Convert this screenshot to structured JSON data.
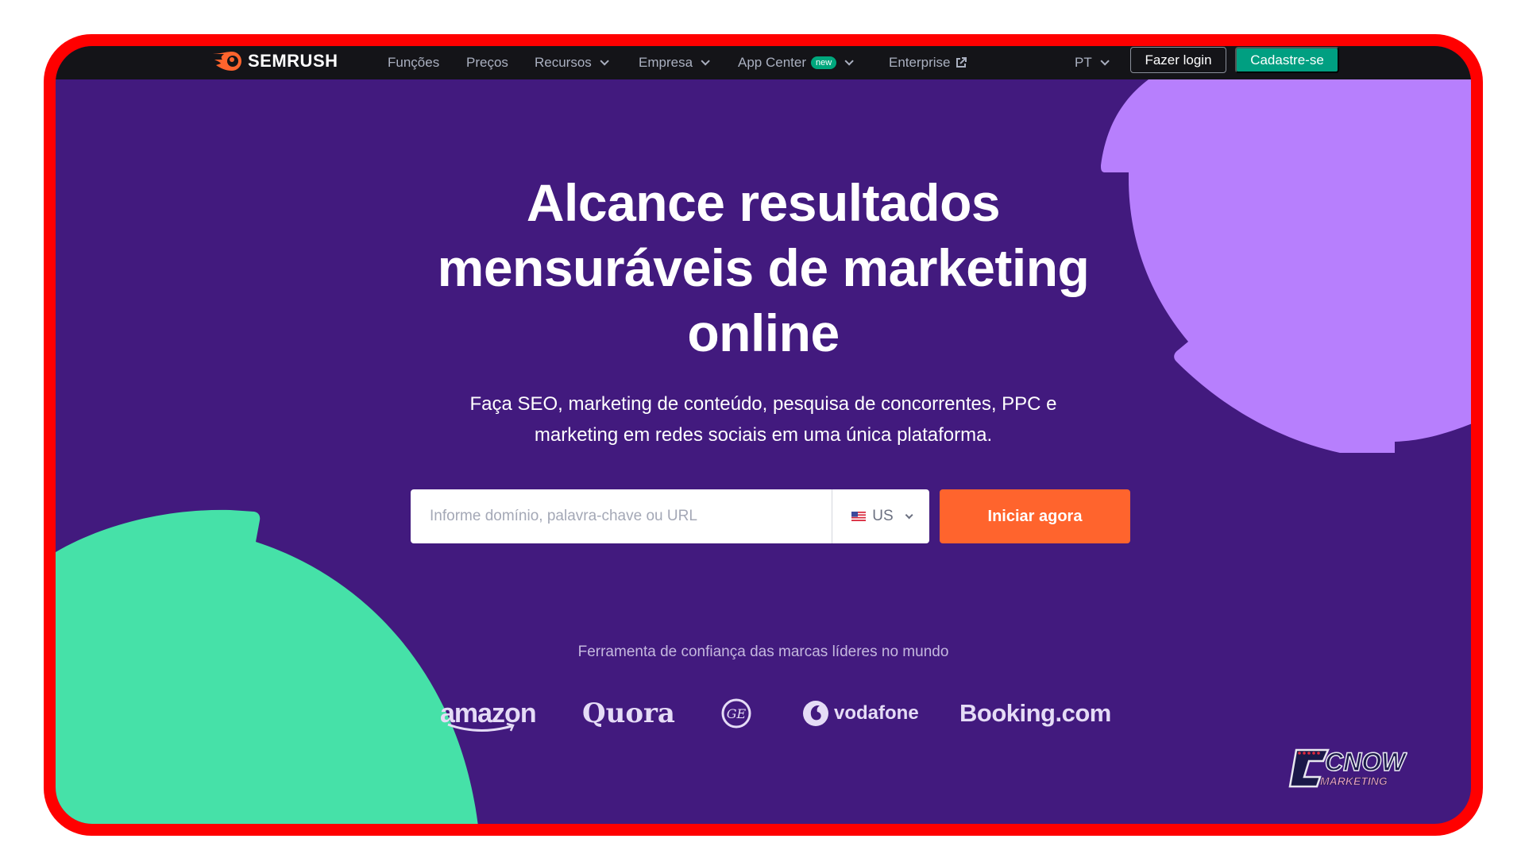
{
  "nav": {
    "logo_text": "SEMRUSH",
    "items": [
      {
        "label": "Funções",
        "has_dropdown": false
      },
      {
        "label": "Preços",
        "has_dropdown": false
      },
      {
        "label": "Recursos",
        "has_dropdown": true
      },
      {
        "label": "Empresa",
        "has_dropdown": true
      },
      {
        "label": "App Center",
        "has_dropdown": true,
        "badge": "new"
      },
      {
        "label": "Enterprise",
        "has_dropdown": false,
        "icon": "external-link-icon"
      }
    ],
    "language": "PT",
    "login_label": "Fazer login",
    "signup_label": "Cadastre-se"
  },
  "hero": {
    "title_lines": [
      "Alcance resultados",
      "mensuráveis de marketing",
      "online"
    ],
    "subtitle_lines": [
      "Faça SEO, marketing de conteúdo, pesquisa de concorrentes, PPC e",
      "marketing em redes sociais em uma única plataforma."
    ]
  },
  "search": {
    "value": "",
    "placeholder": "Informe domínio, palavra-chave ou URL",
    "country": "US",
    "country_flag": "us-flag-icon",
    "submit_label": "Iniciar agora"
  },
  "trust": {
    "heading": "Ferramenta de confiança das marcas líderes no mundo",
    "brands": [
      "amazon",
      "Quora",
      "GE",
      "vodafone",
      "Booking.com"
    ]
  },
  "watermark": {
    "line1": "CNOW",
    "line2": "MARKETING"
  },
  "colors": {
    "background": "#421a7e",
    "nav": "#141418",
    "accent_orange": "#ff642d",
    "accent_green": "#009f81",
    "shape_purple": "#b77ffd",
    "shape_green": "#46e1a8",
    "frame": "#ff0000"
  }
}
